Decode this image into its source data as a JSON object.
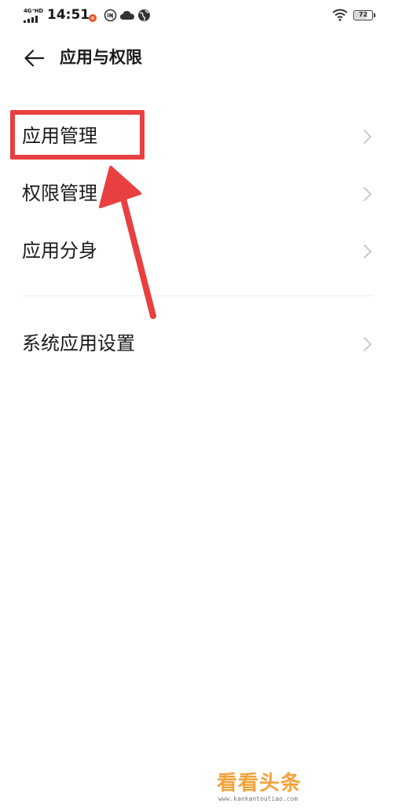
{
  "status_bar": {
    "network": "4G⁺HD",
    "time": "14:51",
    "battery_level": 72,
    "battery_text": "72",
    "icons": [
      "notification-dot-icon",
      "nfc-badge-icon",
      "cloud-icon",
      "globe-icon",
      "wifi-icon",
      "battery-icon"
    ],
    "colors": {
      "notification_dot": "#e2582b"
    }
  },
  "header": {
    "title": "应用与权限"
  },
  "menu": {
    "items": [
      {
        "label": "应用管理",
        "highlighted": true
      },
      {
        "label": "权限管理"
      },
      {
        "label": "应用分身"
      },
      {
        "label": "系统应用设置"
      }
    ]
  },
  "annotation": {
    "color": "#e84040"
  },
  "watermark": {
    "main": "看看头条",
    "url": "www.kankantoutiao.com",
    "colors": {
      "main": "#f2a33a",
      "accent": "#e85a3a"
    }
  }
}
